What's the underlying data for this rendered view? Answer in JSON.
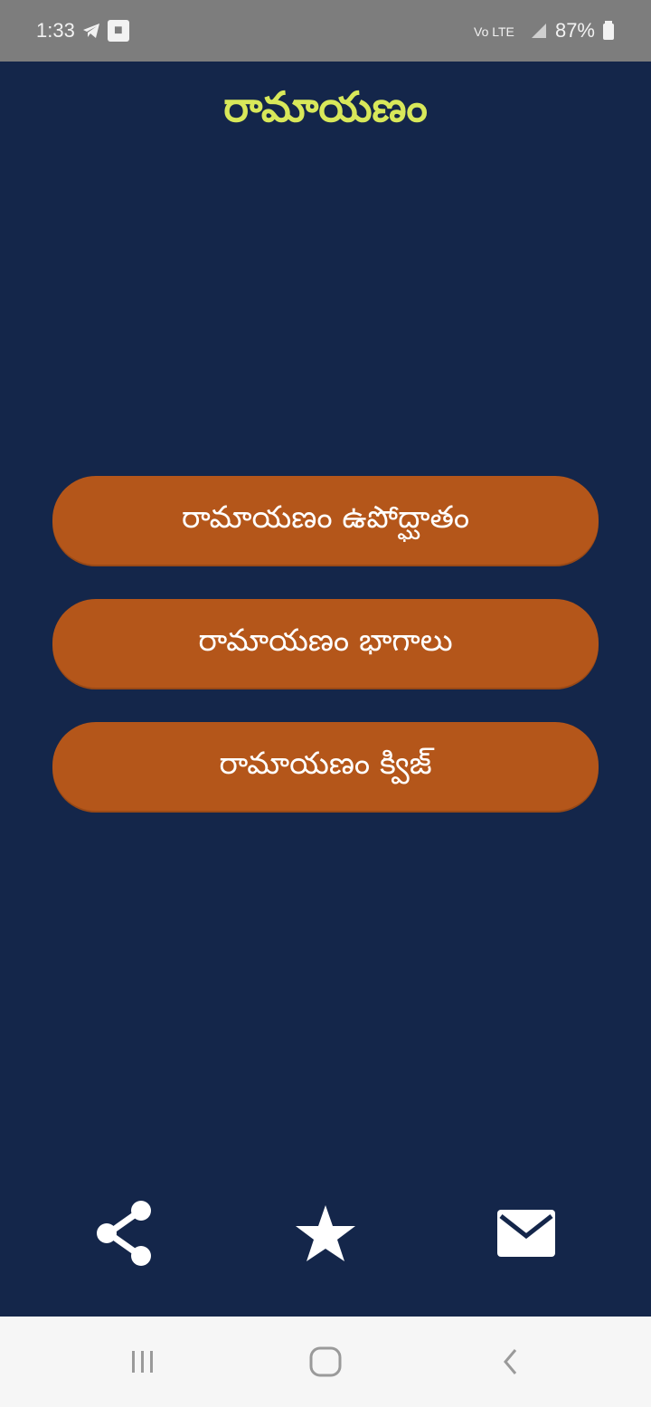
{
  "status_bar": {
    "time": "1:33",
    "right_text": "87%"
  },
  "header": {
    "title": "రామాయణం"
  },
  "menu": {
    "items": [
      {
        "label": "రామాయణం ఉపోద్ఘాతం"
      },
      {
        "label": "రామాయణం భాగాలు"
      },
      {
        "label": "రామాయణం క్విజ్"
      }
    ]
  },
  "actions": {
    "icons": [
      "share-icon",
      "star-icon",
      "mail-icon"
    ]
  },
  "colors": {
    "background": "#14264a",
    "title": "#d8e85a",
    "button": "#b4561a",
    "button_text": "#ffffff"
  }
}
